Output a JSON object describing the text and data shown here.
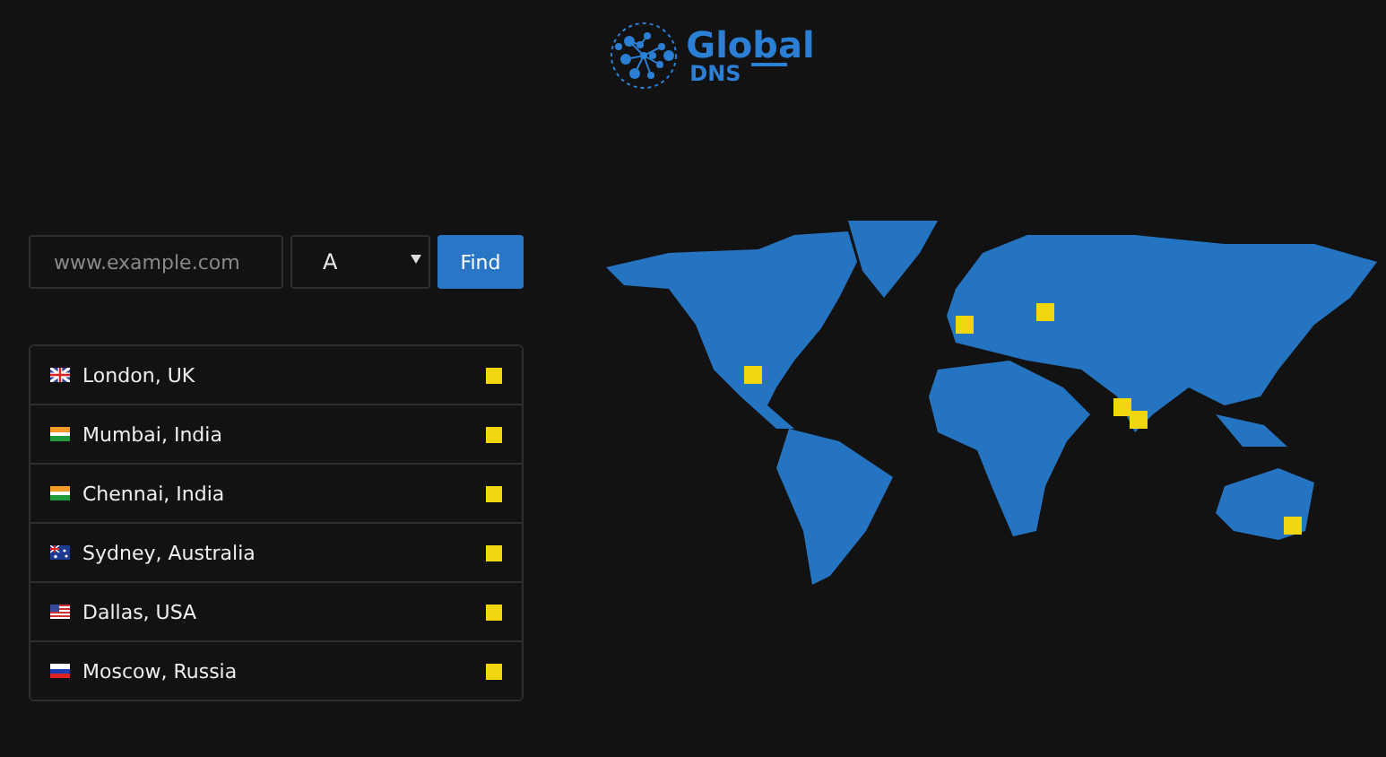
{
  "logo": {
    "title": "Global",
    "subtitle": "DNS"
  },
  "search": {
    "placeholder": "www.example.com",
    "record_type": "A",
    "button": "Find"
  },
  "locations": [
    {
      "name": "London, UK",
      "kind": "uk"
    },
    {
      "name": "Mumbai, India",
      "kind": "india"
    },
    {
      "name": "Chennai, India",
      "kind": "india"
    },
    {
      "name": "Sydney, Australia",
      "kind": "australia"
    },
    {
      "name": "Dallas, USA",
      "kind": "usa"
    },
    {
      "name": "Moscow, Russia",
      "kind": "russia"
    }
  ]
}
